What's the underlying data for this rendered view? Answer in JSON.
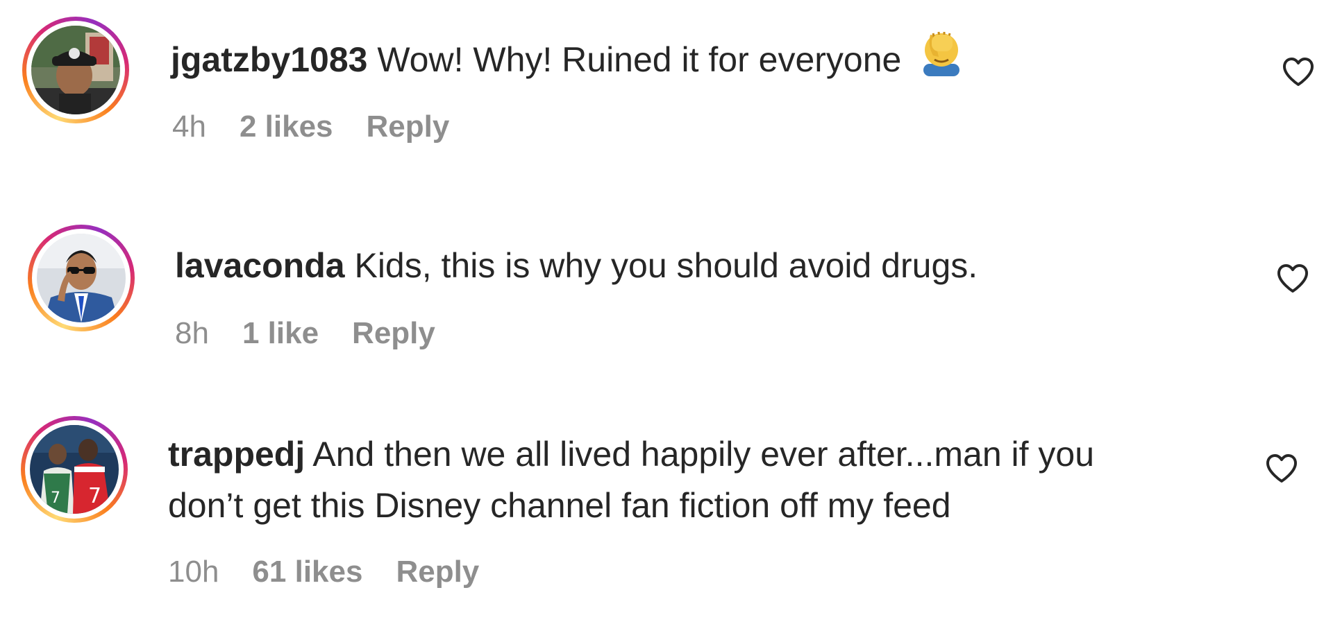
{
  "comments": [
    {
      "username": "jgatzby1083",
      "text": "Wow! Why! Ruined it for everyone",
      "emoji": "face-palm-emoji",
      "time": "4h",
      "likes": "2 likes",
      "reply": "Reply"
    },
    {
      "username": "lavaconda",
      "text": "Kids, this is why you should avoid drugs.",
      "time": "8h",
      "likes": "1 like",
      "reply": "Reply"
    },
    {
      "username": "trappedj",
      "text_line1": "And then we all lived happily ever after...man if you",
      "text_line2": "don’t get this Disney channel fan fiction off my feed",
      "time": "10h",
      "likes": "61 likes",
      "reply": "Reply"
    }
  ],
  "icons": {
    "like": "heart-outline-icon"
  },
  "colors": {
    "text": "#262626",
    "secondary_text": "#8e8e8e",
    "story_ring": [
      "#feda75",
      "#fa7e1e",
      "#d62976",
      "#962fbf"
    ]
  }
}
